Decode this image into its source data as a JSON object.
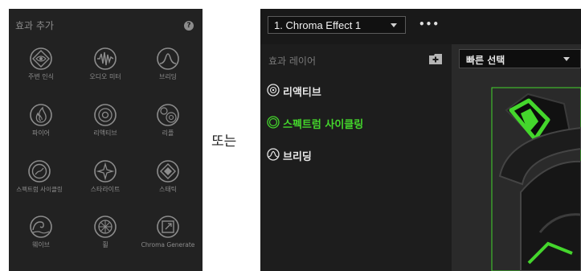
{
  "left_panel": {
    "title": "효과 추가",
    "help": "?",
    "effects": [
      {
        "label": "주변 인식",
        "icon": "ambient-awareness-icon"
      },
      {
        "label": "오디오 미터",
        "icon": "audio-meter-icon"
      },
      {
        "label": "브리딩",
        "icon": "breathing-icon"
      },
      {
        "label": "파이어",
        "icon": "fire-icon"
      },
      {
        "label": "리액티브",
        "icon": "reactive-icon"
      },
      {
        "label": "리플",
        "icon": "ripple-icon"
      },
      {
        "label": "스펙트럼 사이클링",
        "icon": "spectrum-cycling-icon"
      },
      {
        "label": "스타라이트",
        "icon": "starlight-icon"
      },
      {
        "label": "스태틱",
        "icon": "static-icon"
      },
      {
        "label": "웨이브",
        "icon": "wave-icon"
      },
      {
        "label": "휠",
        "icon": "wheel-icon"
      },
      {
        "label": "Chroma Generate",
        "icon": "chroma-generate-icon"
      }
    ]
  },
  "connector_text": "또는",
  "right_panel": {
    "profile_select": "1. Chroma Effect 1",
    "more": "•••",
    "layers_title": "효과 레이어",
    "layers": [
      {
        "label": "리액티브",
        "color": "#e6e6e6",
        "icon": "reactive-icon"
      },
      {
        "label": "스펙트럼 사이클링",
        "color": "#44d62c",
        "icon": "spectrum-cycling-icon"
      },
      {
        "label": "브리딩",
        "color": "#e6e6e6",
        "icon": "breathing-icon"
      }
    ],
    "quick_select": "빠른 선택"
  },
  "colors": {
    "accent": "#44d62c",
    "panel": "#222222",
    "icon_gray": "#8c8c8c"
  }
}
